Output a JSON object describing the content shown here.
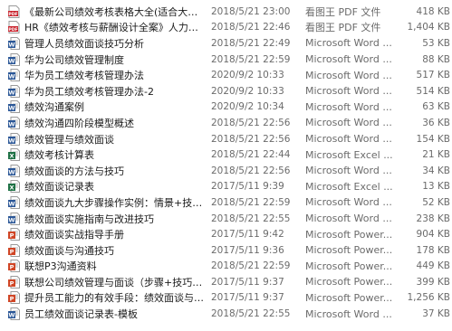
{
  "files": [
    {
      "icon": "pdf-icon",
      "name": "《最新公司绩效考核表格大全(适合大小...",
      "date": "2018/5/21 23:00",
      "type": "看图王 PDF 文件",
      "size": "418 KB"
    },
    {
      "icon": "pdf-icon",
      "name": "HR《绩效考核与薪酬设计全案》人力资...",
      "date": "2018/5/21 22:46",
      "type": "看图王 PDF 文件",
      "size": "1,404 KB"
    },
    {
      "icon": "word-icon",
      "name": "管理人员绩效面谈技巧分析",
      "date": "2018/5/21 22:49",
      "type": "Microsoft Word ...",
      "size": "53 KB"
    },
    {
      "icon": "word-icon",
      "name": "华为公司绩效管理制度",
      "date": "2018/5/21 22:59",
      "type": "Microsoft Word ...",
      "size": "88 KB"
    },
    {
      "icon": "word-icon",
      "name": "华为员工绩效考核管理办法",
      "date": "2020/9/2 10:33",
      "type": "Microsoft Word ...",
      "size": "517 KB"
    },
    {
      "icon": "word-icon",
      "name": "华为员工绩效考核管理办法-2",
      "date": "2020/9/2 10:33",
      "type": "Microsoft Word ...",
      "size": "514 KB"
    },
    {
      "icon": "word-icon",
      "name": "绩效沟通案例",
      "date": "2020/9/2 10:34",
      "type": "Microsoft Word ...",
      "size": "63 KB"
    },
    {
      "icon": "word-icon",
      "name": "绩效沟通四阶段模型概述",
      "date": "2018/5/21 22:56",
      "type": "Microsoft Word ...",
      "size": "36 KB"
    },
    {
      "icon": "word-icon",
      "name": "绩效管理与绩效面谈",
      "date": "2018/5/21 22:56",
      "type": "Microsoft Word ...",
      "size": "154 KB"
    },
    {
      "icon": "excel-icon",
      "name": "绩效考核计算表",
      "date": "2018/5/21 22:44",
      "type": "Microsoft Excel ...",
      "size": "21 KB"
    },
    {
      "icon": "word-icon",
      "name": "绩效面谈的方法与技巧",
      "date": "2018/5/21 22:56",
      "type": "Microsoft Word ...",
      "size": "34 KB"
    },
    {
      "icon": "excel-icon",
      "name": "绩效面谈记录表",
      "date": "2017/5/11 9:39",
      "type": "Microsoft Excel ...",
      "size": "13 KB"
    },
    {
      "icon": "word-icon",
      "name": "绩效面谈九大步骤操作实例：情景+技巧...",
      "date": "2018/5/21 22:59",
      "type": "Microsoft Word ...",
      "size": "52 KB"
    },
    {
      "icon": "word-icon",
      "name": "绩效面谈实施指南与改进技巧",
      "date": "2018/5/21 22:55",
      "type": "Microsoft Word ...",
      "size": "238 KB"
    },
    {
      "icon": "ppt-icon",
      "name": "绩效面谈实战指导手册",
      "date": "2017/5/11 9:42",
      "type": "Microsoft Power...",
      "size": "904 KB"
    },
    {
      "icon": "ppt-icon",
      "name": "绩效面谈与沟通技巧",
      "date": "2017/5/11 9:36",
      "type": "Microsoft Power...",
      "size": "178 KB"
    },
    {
      "icon": "ppt-icon",
      "name": "联想P3沟通资料",
      "date": "2018/5/21 22:59",
      "type": "Microsoft Power...",
      "size": "449 KB"
    },
    {
      "icon": "ppt-icon",
      "name": "联想公司绩效管理与面谈（步骤+技巧+...",
      "date": "2017/5/11 9:37",
      "type": "Microsoft Power...",
      "size": "399 KB"
    },
    {
      "icon": "ppt-icon",
      "name": "提升员工能力的有效手段：绩效面谈与改...",
      "date": "2017/5/11 9:37",
      "type": "Microsoft Power...",
      "size": "1,256 KB"
    },
    {
      "icon": "word-icon",
      "name": "员工绩效面谈记录表-模板",
      "date": "2018/5/21 22:55",
      "type": "Microsoft Word ...",
      "size": "37 KB"
    }
  ],
  "colors": {
    "pdf": "#c8202a",
    "word": "#2b5797",
    "excel": "#1e7145",
    "ppt": "#d04525"
  }
}
